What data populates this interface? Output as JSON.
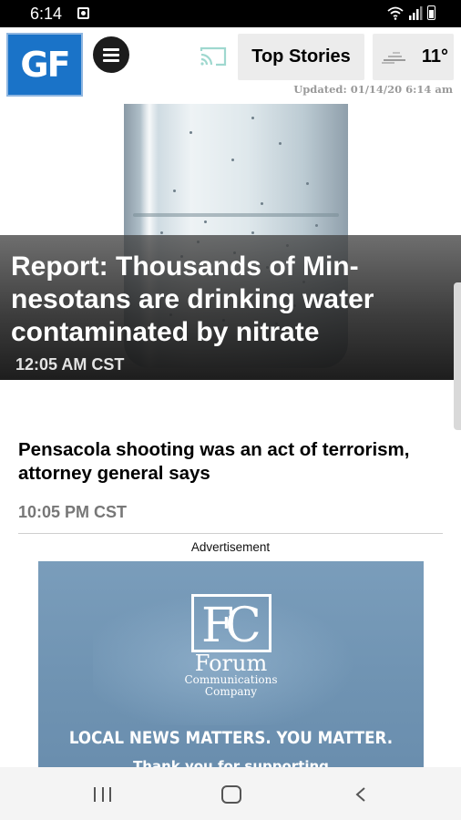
{
  "status_bar": {
    "time": "6:14"
  },
  "header": {
    "logo_text": "GF",
    "top_stories_label": "Top Stories",
    "weather_temp": "11°",
    "updated": "Updated: 01/14/20 6:14 am"
  },
  "hero": {
    "headline": "Report: Thousands of Min-nesotans are drinking water contaminated by nitrate",
    "timestamp": "12:05 AM CST"
  },
  "story": {
    "headline": "Pensacola shooting was an act of terrorism, attorney general says",
    "timestamp": "10:05 PM CST"
  },
  "ad": {
    "label": "Advertisement",
    "brand_name": "Forum",
    "brand_sub_1": "Communications",
    "brand_sub_2": "Company",
    "slogan": "LOCAL NEWS MATTERS. YOU MATTER.",
    "thanks": "Thank you for supporting"
  },
  "icons": {
    "notification": "notification-icon",
    "wifi": "wifi-icon",
    "signal": "signal-icon",
    "battery": "battery-icon",
    "menu": "menu-icon",
    "cast": "cast-icon",
    "weather": "cloud-icon",
    "nav_recents": "recents-icon",
    "nav_home": "home-icon",
    "nav_back": "back-icon"
  },
  "colors": {
    "logo_bg": "#1a73c8",
    "button_bg": "#ececec",
    "ad_bg": "#6f93b2"
  }
}
